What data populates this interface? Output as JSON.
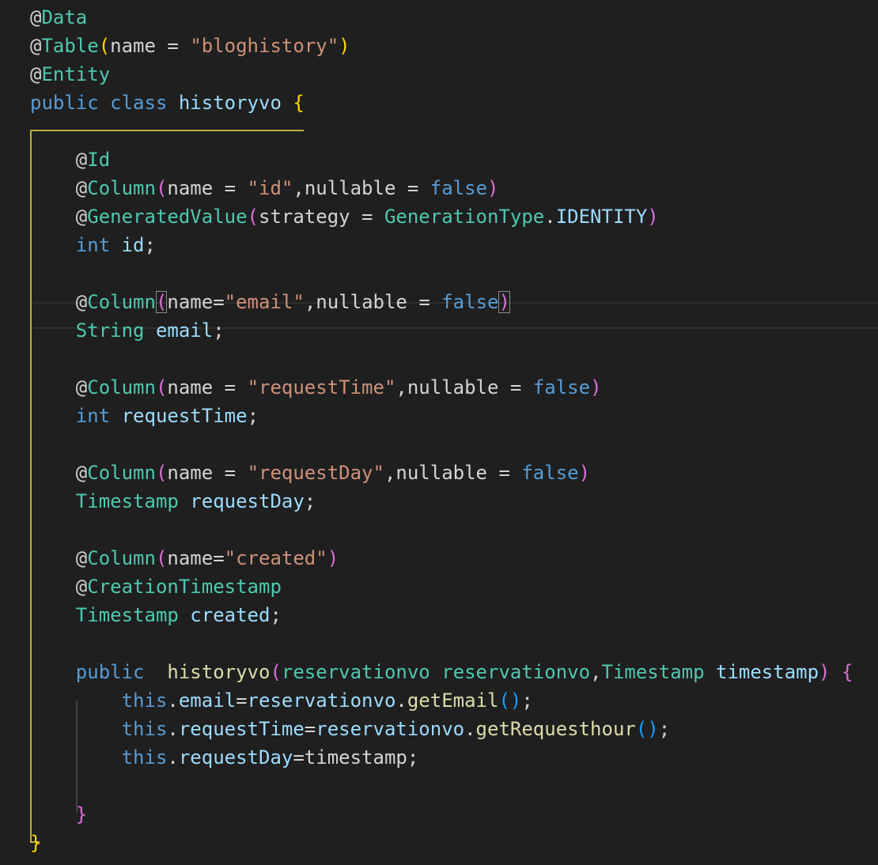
{
  "editor": {
    "code_lines": [
      "@Data",
      "@Table(name = \"bloghistory\")",
      "@Entity",
      "public class historyvo {",
      "",
      "    @Id",
      "    @Column(name = \"id\",nullable = false)",
      "    @GeneratedValue(strategy = GenerationType.IDENTITY)",
      "    int id;",
      "",
      "    @Column(name=\"email\",nullable = false)",
      "    String email;",
      "",
      "    @Column(name = \"requestTime\",nullable = false)",
      "    int requestTime;",
      "",
      "    @Column(name = \"requestDay\",nullable = false)",
      "    Timestamp requestDay;",
      "",
      "    @Column(name=\"created\")",
      "    @CreationTimestamp",
      "    Timestamp created;",
      "",
      "    public  historyvo(reservationvo reservationvo,Timestamp timestamp) {",
      "        this.email=reservationvo.getEmail();",
      "        this.requestTime=reservationvo.getRequesthour();",
      "        this.requestDay=timestamp;",
      "",
      "    }",
      "}"
    ],
    "colors": {
      "background": "#1f1f1f",
      "annotation_type": "#4ec9b0",
      "keyword": "#569cd6",
      "string": "#ce9178",
      "identifier": "#9cdcfe",
      "function": "#dcdcaa",
      "bracket_level_1": "#ffd700",
      "bracket_level_2": "#da70d6",
      "indent_guide_active": "#bfae3b"
    }
  }
}
